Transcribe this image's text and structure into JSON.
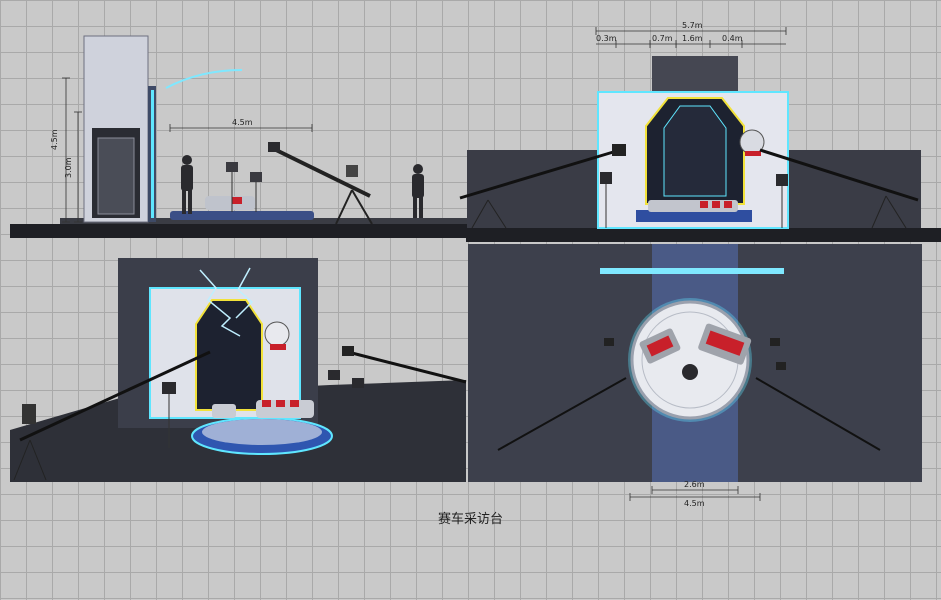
{
  "caption": "赛车采访台",
  "side_elevation": {
    "height_outer": "4.5m",
    "height_inner": "3.0m",
    "width": "4.5m"
  },
  "front_elevation": {
    "total_width": "5.7m",
    "segments": [
      "0.3m",
      "0.7m",
      "1.6m",
      "0.4m"
    ]
  },
  "plan_view": {
    "inner_diameter": "2.6m",
    "outer_width": "4.5m"
  },
  "colors": {
    "neon_yellow": "#f2e23a",
    "neon_cyan": "#5fe6ff",
    "sofa_red": "#c8202a",
    "dark_floor": "#2e3038"
  }
}
